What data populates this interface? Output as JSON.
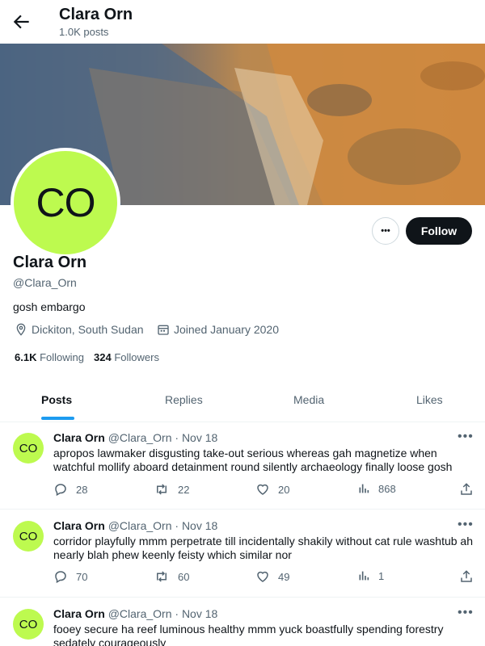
{
  "header": {
    "name": "Clara Orn",
    "post_count": "1.0K posts"
  },
  "profile": {
    "avatar_initials": "CO",
    "name": "Clara Orn",
    "handle": "@Clara_Orn",
    "bio": "gosh embargo",
    "location": "Dickiton, South Sudan",
    "joined": "Joined January 2020",
    "following_count": "6.1K",
    "following_label": "Following",
    "followers_count": "324",
    "followers_label": "Followers",
    "follow_label": "Follow",
    "more_label": "•••"
  },
  "tabs": [
    {
      "label": "Posts",
      "active": true
    },
    {
      "label": "Replies",
      "active": false
    },
    {
      "label": "Media",
      "active": false
    },
    {
      "label": "Likes",
      "active": false
    }
  ],
  "posts": [
    {
      "avatar_initials": "CO",
      "name": "Clara Orn",
      "handle": "@Clara_Orn",
      "date": "· Nov 18",
      "text": "apropos lawmaker disgusting take-out serious whereas gah magnetize when watchful mollify aboard detainment round silently archaeology finally loose gosh",
      "replies": "28",
      "reposts": "22",
      "likes": "20",
      "views": "868"
    },
    {
      "avatar_initials": "CO",
      "name": "Clara Orn",
      "handle": "@Clara_Orn",
      "date": "· Nov 18",
      "text": "corridor playfully mmm perpetrate till incidentally shakily without cat rule washtub ah nearly blah phew keenly feisty which similar nor",
      "replies": "70",
      "reposts": "60",
      "likes": "49",
      "views": "1"
    },
    {
      "avatar_initials": "CO",
      "name": "Clara Orn",
      "handle": "@Clara_Orn",
      "date": "· Nov 18",
      "text": "fooey secure ha reef luminous healthy mmm yuck boastfully spending forestry sedately courageously"
    }
  ],
  "colors": {
    "avatar_bg": "#bdfa4f",
    "accent": "#1d9bf0",
    "follow_bg": "#0f1419"
  }
}
